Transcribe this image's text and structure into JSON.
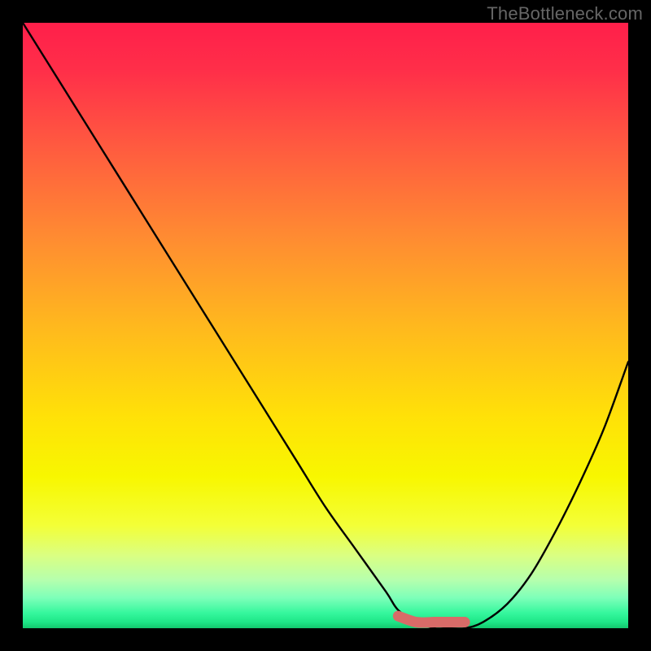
{
  "watermark": "TheBottleneck.com",
  "chart_data": {
    "type": "line",
    "title": "",
    "xlabel": "",
    "ylabel": "",
    "xlim": [
      0,
      100
    ],
    "ylim": [
      0,
      100
    ],
    "series": [
      {
        "name": "curve",
        "x": [
          0,
          5,
          10,
          15,
          20,
          25,
          30,
          35,
          40,
          45,
          50,
          55,
          60,
          62,
          65,
          68,
          70,
          73,
          76,
          80,
          84,
          88,
          92,
          96,
          100
        ],
        "values": [
          100,
          92,
          84,
          76,
          68,
          60,
          52,
          44,
          36,
          28,
          20,
          13,
          6,
          3,
          1,
          0,
          0,
          0,
          1,
          4,
          9,
          16,
          24,
          33,
          44
        ]
      },
      {
        "name": "highlight-band",
        "x": [
          62,
          65,
          68,
          70,
          73
        ],
        "values": [
          2,
          1,
          1,
          1,
          1
        ]
      }
    ],
    "colors": {
      "curve": "#000000",
      "highlight": "#d86b68"
    }
  }
}
